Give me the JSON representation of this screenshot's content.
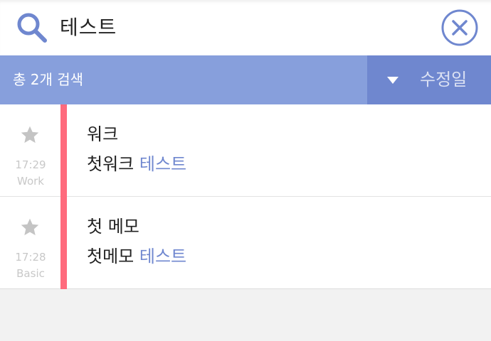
{
  "search": {
    "query": "테스트"
  },
  "results": {
    "count_label": "총 2개 검색",
    "sort_label": "수정일"
  },
  "colors": {
    "header_bar": "#879fdc",
    "sort_bg": "#6f87cf",
    "accent": "#6f87cf",
    "note_color_bar": "#ff6b7d"
  },
  "notes": [
    {
      "time": "17:29",
      "category": "Work",
      "title": "워크",
      "body_prefix": "첫워크 ",
      "body_match": "테스트",
      "starred": false
    },
    {
      "time": "17:28",
      "category": "Basic",
      "title": "첫 메모",
      "body_prefix": "첫메모 ",
      "body_match": "테스트",
      "starred": false
    }
  ]
}
